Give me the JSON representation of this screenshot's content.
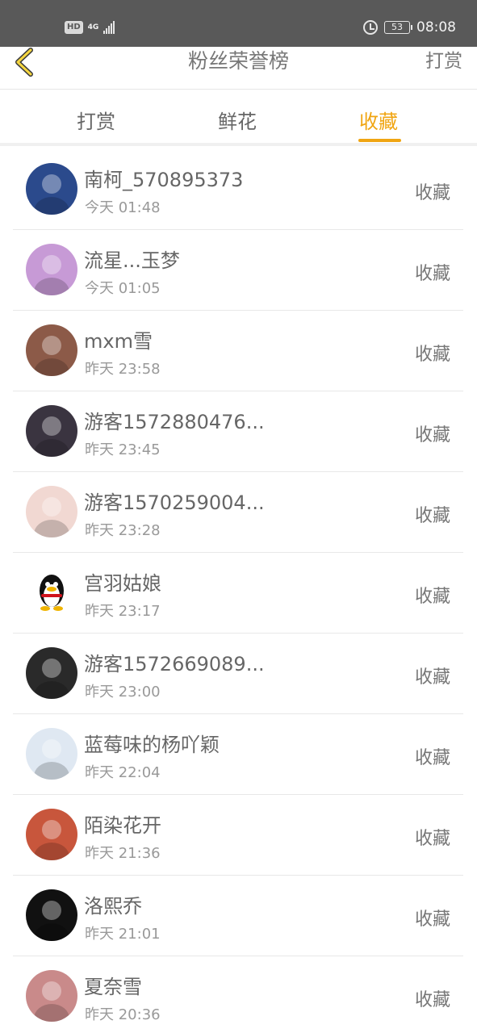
{
  "status_bar": {
    "hd": "HD",
    "network": "4G",
    "battery": "53",
    "time": "08:08"
  },
  "header": {
    "back_icon": "chevron-left-icon",
    "title": "粉丝荣誉榜",
    "right_button": "打赏"
  },
  "tabs": [
    {
      "label": "打赏",
      "active": false
    },
    {
      "label": "鲜花",
      "active": false
    },
    {
      "label": "收藏",
      "active": true
    }
  ],
  "accent_color": "#f0a512",
  "list": [
    {
      "name": "南柯_570895373",
      "time": "今天 01:48",
      "action": "收藏",
      "avatar_color": "#2b4a8c"
    },
    {
      "name": "流星...玉梦",
      "time": "今天 01:05",
      "action": "收藏",
      "avatar_color": "#c79ad6"
    },
    {
      "name": "mxm雪",
      "time": "昨天 23:58",
      "action": "收藏",
      "avatar_color": "#8c5a48"
    },
    {
      "name": "游客1572880476...",
      "time": "昨天 23:45",
      "action": "收藏",
      "avatar_color": "#3a3440"
    },
    {
      "name": "游客1570259004...",
      "time": "昨天 23:28",
      "action": "收藏",
      "avatar_color": "#f1d8d2"
    },
    {
      "name": "宫羽姑娘",
      "time": "昨天 23:17",
      "action": "收藏",
      "avatar_color": "#ffffff"
    },
    {
      "name": "游客1572669089...",
      "time": "昨天 23:00",
      "action": "收藏",
      "avatar_color": "#2a2a2a"
    },
    {
      "name": "蓝莓味的杨吖颖",
      "time": "昨天 22:04",
      "action": "收藏",
      "avatar_color": "#dfe8f2"
    },
    {
      "name": "陌染花开",
      "time": "昨天 21:36",
      "action": "收藏",
      "avatar_color": "#c8563c"
    },
    {
      "name": "洛熙乔",
      "time": "昨天 21:01",
      "action": "收藏",
      "avatar_color": "#111111"
    },
    {
      "name": "夏奈雪",
      "time": "昨天 20:36",
      "action": "收藏",
      "avatar_color": "#c98a8a"
    }
  ]
}
